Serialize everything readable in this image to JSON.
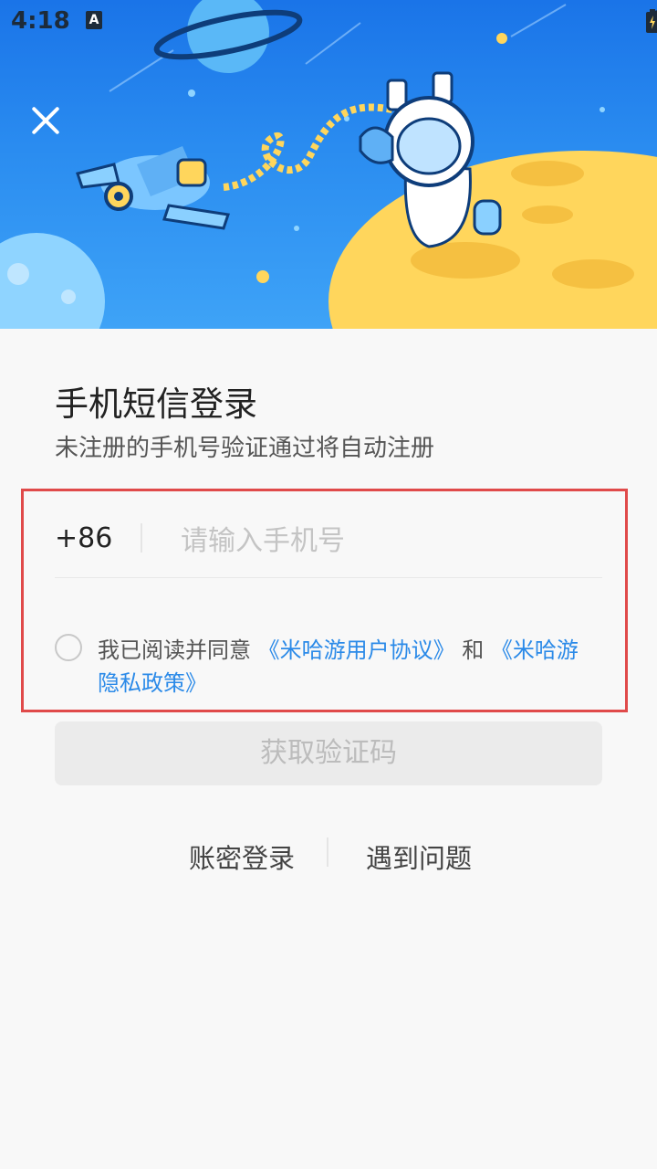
{
  "status_bar": {
    "time": "4:18",
    "notification_icon": "a-icon",
    "icons": [
      "wifi-icon",
      "signal-icon",
      "battery-icon"
    ]
  },
  "hero": {
    "illustration": "astronaut-on-moon-with-spaceship",
    "close_icon": "close-icon"
  },
  "login": {
    "title": "手机短信登录",
    "subtitle": "未注册的手机号验证通过将自动注册",
    "country_code": "+86",
    "phone_placeholder": "请输入手机号",
    "phone_value": "",
    "agreement": {
      "prefix": "我已阅读并同意 ",
      "user_agreement": "《米哈游用户协议》",
      "conjunction": " 和 ",
      "privacy_policy": "《米哈游隐私政策》",
      "checked": false
    },
    "get_code_button": "获取验证码",
    "password_login": "账密登录",
    "help": "遇到问题"
  },
  "colors": {
    "hero_top": "#1a74e8",
    "hero_bottom": "#3ea3f7",
    "link_blue": "#2b8ae8",
    "highlight_red": "#e04a4a",
    "moon_yellow": "#ffd65c"
  }
}
